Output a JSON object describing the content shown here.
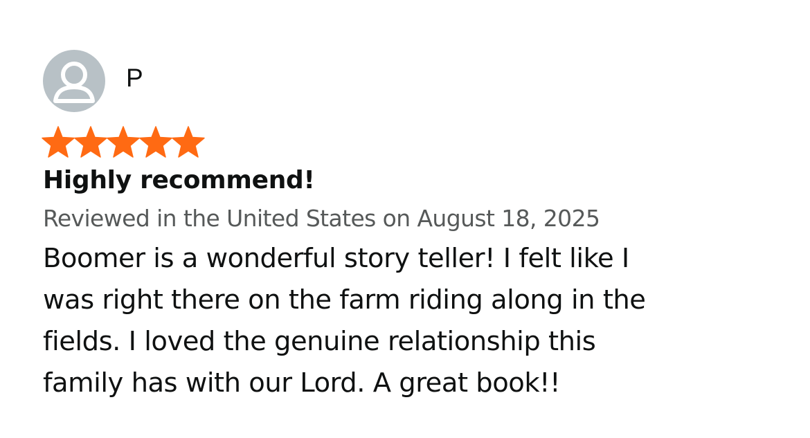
{
  "reviewer": {
    "name": "P",
    "avatar_icon": "default-profile-icon"
  },
  "rating": {
    "value": 5,
    "max": 5,
    "star_color": "#ff6a13",
    "star_icon": "star-icon"
  },
  "review": {
    "title": "Highly recommend!",
    "meta": "Reviewed in the United States on August 18, 2025",
    "body_lines": [
      "Boomer is a wonderful story teller! I felt like I",
      "was right there on the farm riding along in the",
      "fields. I loved the genuine relationship this",
      "family has with our Lord. A great book!!"
    ]
  }
}
